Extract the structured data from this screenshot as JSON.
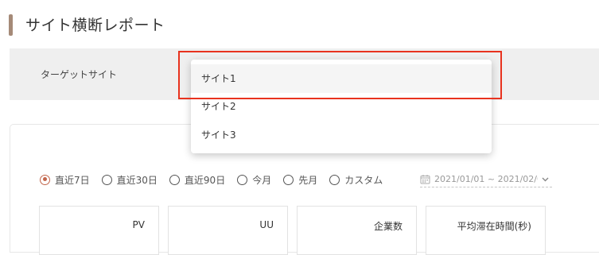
{
  "header": {
    "title": "サイト横断レポート"
  },
  "target": {
    "label": "ターゲットサイト",
    "dropdown": {
      "options": [
        {
          "label": "サイト1",
          "hovered": true
        },
        {
          "label": "サイト2"
        },
        {
          "label": "サイト3"
        }
      ]
    }
  },
  "period": {
    "options": [
      {
        "label": "直近7日",
        "checked": true
      },
      {
        "label": "直近30日"
      },
      {
        "label": "直近90日"
      },
      {
        "label": "今月"
      },
      {
        "label": "先月"
      },
      {
        "label": "カスタム"
      }
    ],
    "date_range": "2021/01/01 ~ 2021/02/0"
  },
  "metrics": [
    {
      "label": "PV"
    },
    {
      "label": "UU"
    },
    {
      "label": "企業数"
    },
    {
      "label": "平均滞在時間(秒)"
    }
  ],
  "colors": {
    "accent": "#c2654b",
    "highlight": "#e8321e",
    "title_bar": "#a58a78"
  }
}
